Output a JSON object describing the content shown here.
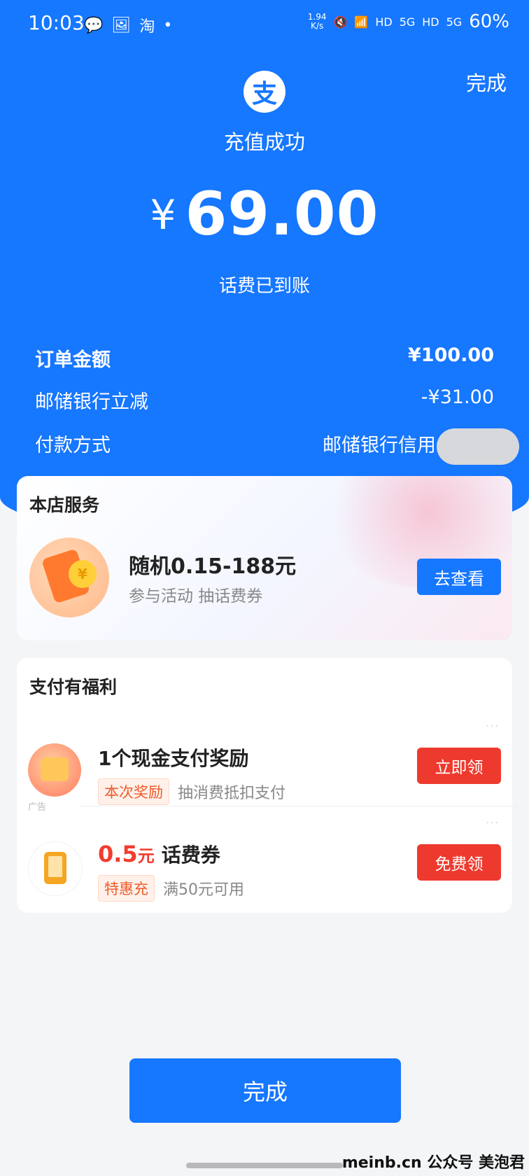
{
  "status_bar": {
    "time": "10:03",
    "left_icons": [
      "wechat-icon",
      "gallery-icon",
      "taobao-icon",
      "dot"
    ],
    "taobao_label": "淘",
    "net_speed_value": "1.94",
    "net_speed_unit": "K/s",
    "hd_label_1": "HD",
    "hd_label_2": "HD",
    "signal_label_1": "5G",
    "signal_label_2": "5G",
    "battery": "60%"
  },
  "header": {
    "done_label": "完成",
    "logo_char": "支",
    "title": "充值成功",
    "currency": "¥",
    "amount": "69.00",
    "subtitle": "话费已到账"
  },
  "details": [
    {
      "label": "订单金额",
      "value": "¥100.00"
    },
    {
      "label": "邮储银行立减",
      "value": "-¥31.00"
    },
    {
      "label": "付款方式",
      "value": "邮储银行信用卡"
    }
  ],
  "store_service": {
    "title": "本店服务",
    "coin_char": "¥",
    "promo_title": "随机0.15-188元",
    "promo_sub": "参与活动 抽话费券",
    "button": "去查看"
  },
  "benefits": {
    "title": "支付有福利",
    "items": [
      {
        "title": "1个现金支付奖励",
        "tag": "本次奖励",
        "desc": "抽消费抵扣支付",
        "button": "立即领",
        "ad_label": "广告",
        "more": "···"
      },
      {
        "amount": "0.5",
        "unit": "元",
        "title": "话费券",
        "tag": "特惠充",
        "desc": "满50元可用",
        "button": "免费领",
        "more": "···"
      }
    ]
  },
  "footer": {
    "done_label": "完成",
    "watermark": "meinb.cn 公众号 美泡君"
  },
  "colors": {
    "primary": "#1677ff",
    "accent_red": "#ee3a2e"
  }
}
